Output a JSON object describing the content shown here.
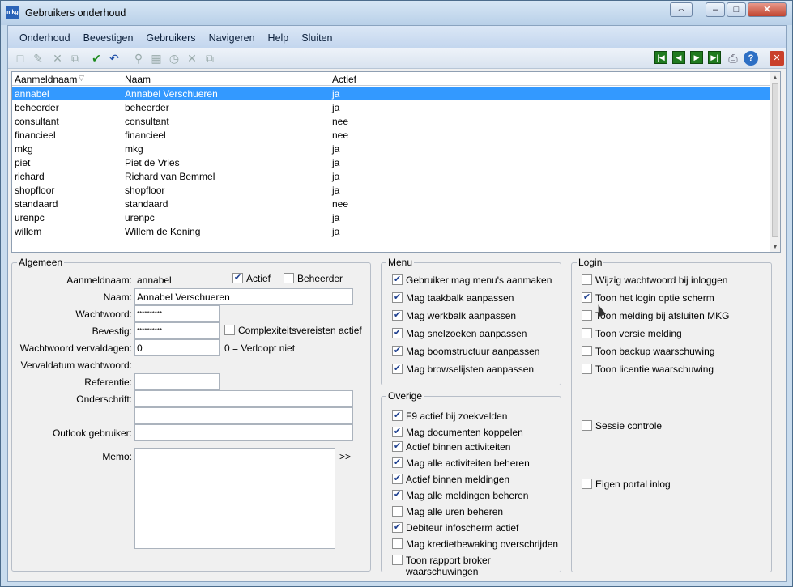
{
  "window": {
    "title": "Gebruikers onderhoud",
    "icon_text": "mkg",
    "controls": {
      "resize": "⇔",
      "min": "–",
      "max": "□",
      "close": "✕"
    }
  },
  "menu": [
    "Onderhoud",
    "Bevestigen",
    "Gebruikers",
    "Navigeren",
    "Help",
    "Sluiten"
  ],
  "toolbar": {
    "icons": [
      "new-icon",
      "edit-icon",
      "delete-icon",
      "copy-icon",
      "confirm-icon",
      "undo-icon",
      "search-icon",
      "calendar-icon",
      "clock-icon",
      "cancel-icon",
      "paste-icon"
    ],
    "nav": [
      "|◀",
      "◀",
      "▶",
      "▶|"
    ],
    "print": "⎙",
    "help": "?",
    "close": "✕"
  },
  "grid": {
    "headers": [
      "Aanmeldnaam",
      "Naam",
      "Actief"
    ],
    "filter_icon": "filter-icon",
    "rows": [
      [
        "annabel",
        "Annabel Verschueren",
        "ja"
      ],
      [
        "beheerder",
        "beheerder",
        "ja"
      ],
      [
        "consultant",
        "consultant",
        "nee"
      ],
      [
        "financieel",
        "financieel",
        "nee"
      ],
      [
        "mkg",
        "mkg",
        "ja"
      ],
      [
        "piet",
        "Piet de Vries",
        "ja"
      ],
      [
        "richard",
        "Richard van Bemmel",
        "ja"
      ],
      [
        "shopfloor",
        "shopfloor",
        "ja"
      ],
      [
        "standaard",
        "standaard",
        "nee"
      ],
      [
        "urenpc",
        "urenpc",
        "ja"
      ],
      [
        "willem",
        "Willem de Koning",
        "ja"
      ]
    ]
  },
  "algemeen": {
    "title": "Algemeen",
    "aanmeldnaam_label": "Aanmeldnaam:",
    "aanmeldnaam": "annabel",
    "actief_label": "Actief",
    "actief": true,
    "beheerder_label": "Beheerder",
    "beheerder": false,
    "naam_label": "Naam:",
    "naam": "Annabel Verschueren",
    "wachtwoord_label": "Wachtwoord:",
    "wachtwoord": "**********",
    "bevestig_label": "Bevestig:",
    "bevestig": "**********",
    "complex_label": "Complexiteitsvereisten actief",
    "complex": false,
    "vervaldagen_label": "Wachtwoord vervaldagen:",
    "vervaldagen": "0",
    "vervaldagen_hint": "0 = Verloopt niet",
    "vervaldatum_label": "Vervaldatum wachtwoord:",
    "referentie_label": "Referentie:",
    "referentie": "",
    "onderschrift_label": "Onderschrift:",
    "onderschrift1": "",
    "onderschrift2": "",
    "outlook_label": "Outlook gebruiker:",
    "outlook": "",
    "memo_label": "Memo:",
    "memo": "",
    "memo_expand": ">>"
  },
  "menu_group": {
    "title": "Menu",
    "items": [
      {
        "label": "Gebruiker mag menu's aanmaken",
        "checked": true
      },
      {
        "label": "Mag taakbalk aanpassen",
        "checked": true
      },
      {
        "label": "Mag werkbalk aanpassen",
        "checked": true
      },
      {
        "label": "Mag snelzoeken aanpassen",
        "checked": true
      },
      {
        "label": "Mag boomstructuur aanpassen",
        "checked": true
      },
      {
        "label": "Mag browselijsten aanpassen",
        "checked": true
      }
    ]
  },
  "overige": {
    "title": "Overige",
    "items": [
      {
        "label": "F9 actief bij zoekvelden",
        "checked": true
      },
      {
        "label": "Mag documenten koppelen",
        "checked": true
      },
      {
        "label": "Actief binnen activiteiten",
        "checked": true
      },
      {
        "label": "Mag alle activiteiten beheren",
        "checked": true
      },
      {
        "label": "Actief binnen meldingen",
        "checked": true
      },
      {
        "label": "Mag alle meldingen beheren",
        "checked": true
      },
      {
        "label": "Mag alle uren beheren",
        "checked": false
      },
      {
        "label": "Debiteur infoscherm actief",
        "checked": true
      },
      {
        "label": "Mag kredietbewaking overschrijden",
        "checked": false
      },
      {
        "label": "Toon rapport broker waarschuwingen",
        "checked": false
      }
    ]
  },
  "login": {
    "title": "Login",
    "items": [
      {
        "label": "Wijzig wachtwoord bij inloggen",
        "checked": false
      },
      {
        "label": "Toon het login optie scherm",
        "checked": true
      },
      {
        "label": "Toon melding bij afsluiten MKG",
        "checked": false
      },
      {
        "label": "Toon versie melding",
        "checked": false
      },
      {
        "label": "Toon backup waarschuwing",
        "checked": false
      },
      {
        "label": "Toon licentie waarschuwing",
        "checked": false
      },
      {
        "label": "Sessie controle",
        "checked": false
      },
      {
        "label": "Eigen portal inlog",
        "checked": false
      }
    ]
  }
}
